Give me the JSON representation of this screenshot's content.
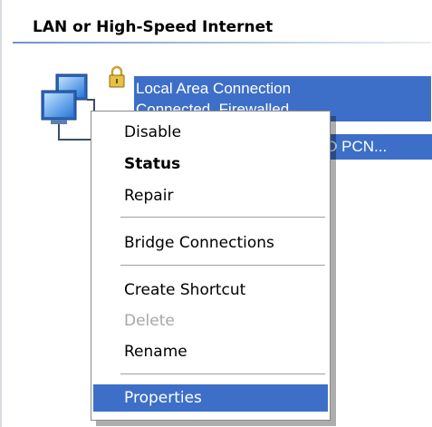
{
  "group": {
    "header": "LAN or High-Speed Internet"
  },
  "connection": {
    "name": "Local Area Connection",
    "status": "Connected, Firewalled",
    "device": "MD PCN..."
  },
  "context_menu": {
    "items": [
      {
        "label": "Disable",
        "style": "normal"
      },
      {
        "label": "Status",
        "style": "bold"
      },
      {
        "label": "Repair",
        "style": "normal"
      },
      {
        "label": "Bridge Connections",
        "style": "normal"
      },
      {
        "label": "Create Shortcut",
        "style": "normal"
      },
      {
        "label": "Delete",
        "style": "disabled"
      },
      {
        "label": "Rename",
        "style": "normal"
      },
      {
        "label": "Properties",
        "style": "selected"
      }
    ]
  },
  "colors": {
    "selection": "#3d6fc8",
    "disabled_text": "#a7a7a7",
    "separator": "#a0a0a0"
  },
  "icons": {
    "connection": "network-connection-icon",
    "lock": "firewall-lock-icon"
  }
}
